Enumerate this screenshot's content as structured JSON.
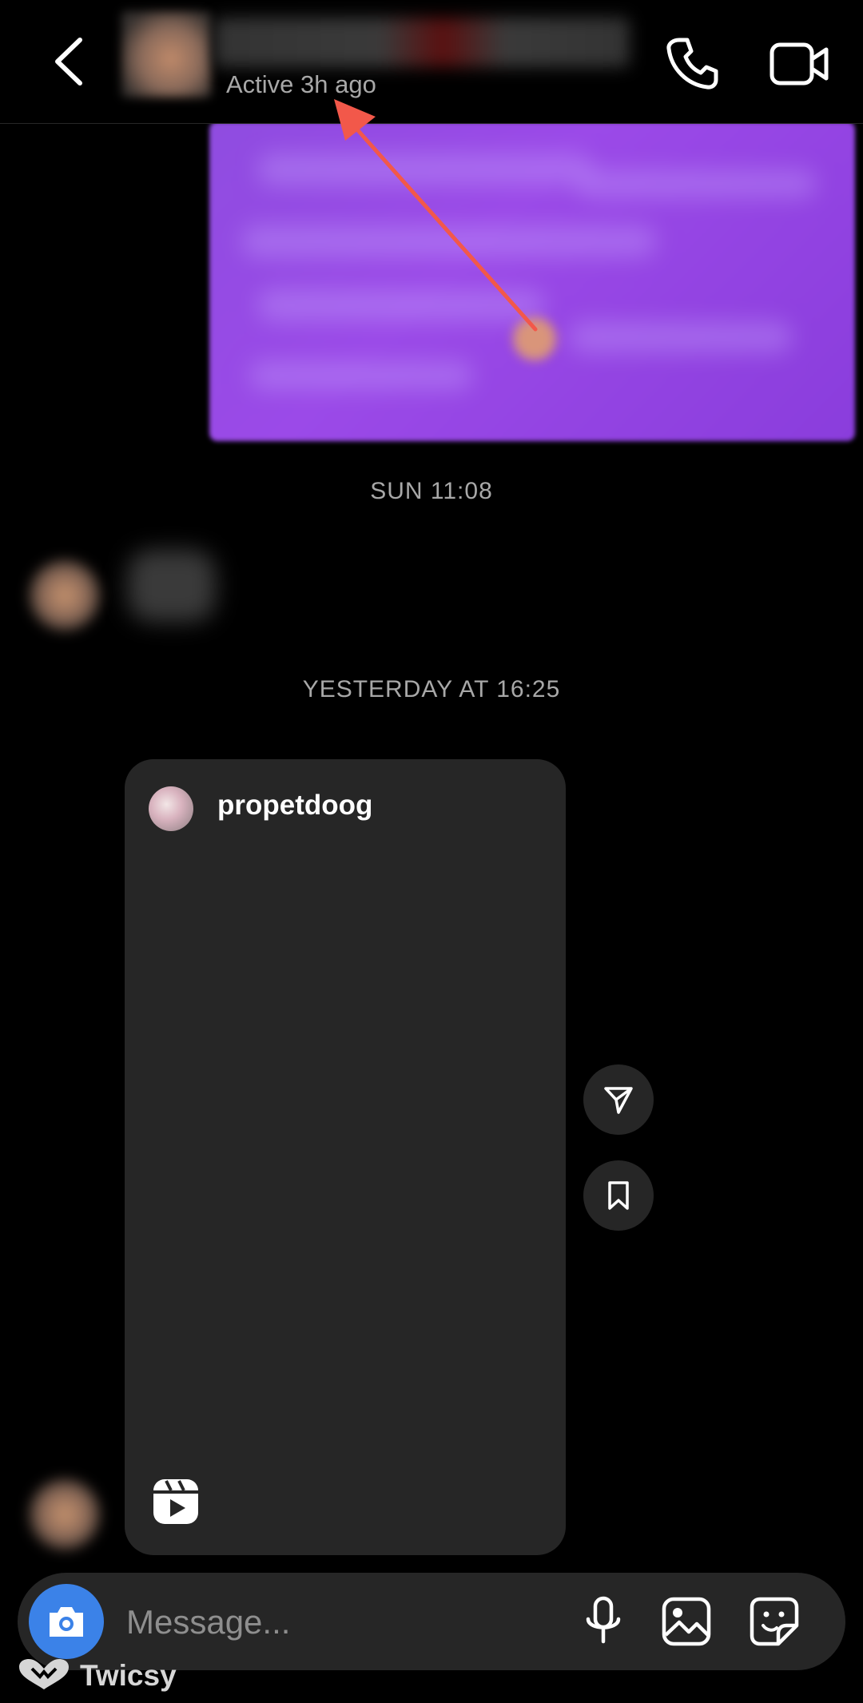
{
  "header": {
    "status": "Active 3h ago",
    "icons": [
      "back-arrow-icon",
      "phone-icon",
      "video-camera-icon"
    ]
  },
  "timestamps": [
    "SUN 11:08",
    "YESTERDAY AT 16:25"
  ],
  "reel": {
    "username": "propetdoog",
    "icons": [
      "reels-icon",
      "send-icon",
      "bookmark-icon"
    ]
  },
  "composer": {
    "placeholder": "Message...",
    "icons": [
      "camera-icon",
      "microphone-icon",
      "gallery-icon",
      "sticker-icon"
    ]
  },
  "watermark": {
    "text": "Twicsy"
  },
  "colors": {
    "accent_blue": "#3b82e8",
    "annotation_arrow": "#f2584a",
    "bubble_purple": "#9b4ae8",
    "card_gray": "#262626"
  }
}
